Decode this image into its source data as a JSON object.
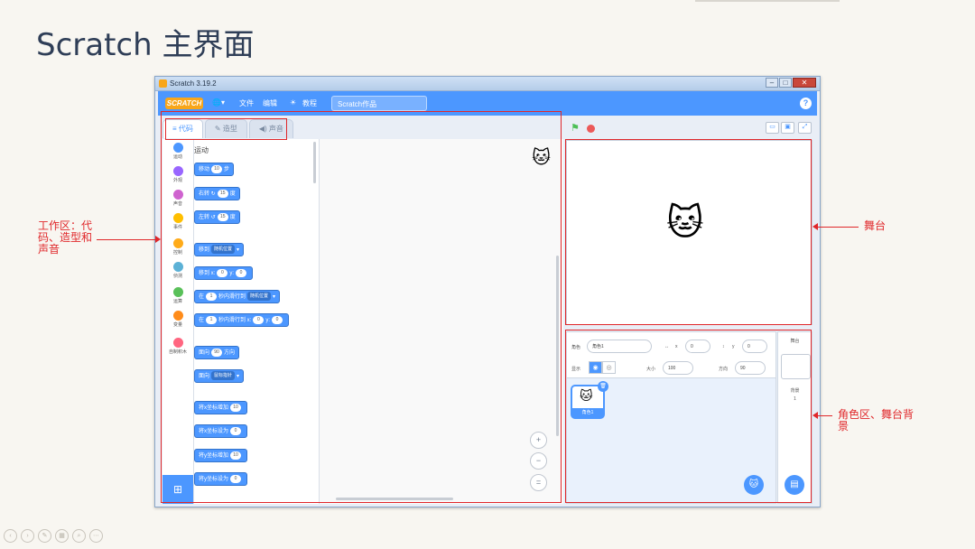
{
  "slide": {
    "title": "Scratch 主界面"
  },
  "window": {
    "title": "Scratch 3.19.2",
    "controls": [
      "minimize",
      "maximize",
      "close"
    ]
  },
  "menubar": {
    "logo": "SCRATCH",
    "items": [
      "文件",
      "编辑",
      "教程"
    ],
    "project_name": "Scratch作品",
    "help": "?"
  },
  "tabs": [
    {
      "label": "代码",
      "icon": "code-icon",
      "active": true
    },
    {
      "label": "造型",
      "icon": "brush-icon",
      "active": false
    },
    {
      "label": "声音",
      "icon": "speaker-icon",
      "active": false
    }
  ],
  "categories": [
    {
      "label": "运动",
      "color": "#4c97ff"
    },
    {
      "label": "外观",
      "color": "#9966ff"
    },
    {
      "label": "声音",
      "color": "#cf63cf"
    },
    {
      "label": "事件",
      "color": "#ffbf00"
    },
    {
      "label": "控制",
      "color": "#ffab19"
    },
    {
      "label": "侦测",
      "color": "#5cb1d6"
    },
    {
      "label": "运算",
      "color": "#59c059"
    },
    {
      "label": "变量",
      "color": "#ff8c1a"
    },
    {
      "label": "自制积木",
      "color": "#ff6680"
    }
  ],
  "palette": {
    "section_title": "运动",
    "blocks": {
      "move": {
        "a": "移动",
        "v": "10",
        "b": "步"
      },
      "turn_right": {
        "a": "右转",
        "v": "15",
        "b": "度"
      },
      "turn_left": {
        "a": "左转",
        "v": "15",
        "b": "度"
      },
      "goto": {
        "a": "移到",
        "d": "随机位置"
      },
      "goto_xy": {
        "a": "移到 x:",
        "x": "0",
        "y_lbl": "y:",
        "y": "0"
      },
      "glide": {
        "a": "在",
        "v": "1",
        "b": "秒内滑行到",
        "d": "随机位置"
      },
      "glide_xy": {
        "a": "在",
        "v": "1",
        "b": "秒内滑行到 x:",
        "x": "0",
        "y_lbl": "y:",
        "y": "0"
      },
      "point_dir": {
        "a": "面向",
        "v": "90",
        "b": "方向"
      },
      "point_to": {
        "a": "面向",
        "d": "鼠标指针"
      },
      "change_x": {
        "a": "将x坐标增加",
        "v": "10"
      },
      "set_x": {
        "a": "将x坐标设为",
        "v": "0"
      },
      "change_y": {
        "a": "将y坐标增加",
        "v": "10"
      },
      "set_y": {
        "a": "将y坐标设为",
        "v": "0"
      }
    }
  },
  "zoom": {
    "in": "+",
    "out": "−",
    "reset": "="
  },
  "sprite_info": {
    "sprite_label": "角色",
    "sprite_name": "角色1",
    "x_label": "x",
    "x": "0",
    "y_label": "y",
    "y": "0",
    "show_label": "显示",
    "size_label": "大小",
    "size": "100",
    "direction_label": "方向",
    "direction": "90"
  },
  "sprite_list": [
    {
      "name": "角色1"
    }
  ],
  "stage_panel": {
    "title": "舞台",
    "backdrop_label": "背景",
    "backdrop_count": "1"
  },
  "annotations": {
    "workspace": "工作区：代码、造型和声音",
    "workspace_l1": "工作区：代",
    "workspace_l2": "码、造型和",
    "workspace_l3": "声音",
    "stage": "舞台",
    "sprite_area_l1": "角色区、舞台背",
    "sprite_area_l2": "景"
  },
  "chart_data": {
    "type": "table",
    "title": "Scratch 主界面",
    "annotations": [
      "工作区：代码、造型和声音",
      "舞台",
      "角色区、舞台背景"
    ]
  },
  "colors": {
    "accent": "#4c97ff",
    "annotation": "#e0272a",
    "background": "#f8f6f1"
  }
}
